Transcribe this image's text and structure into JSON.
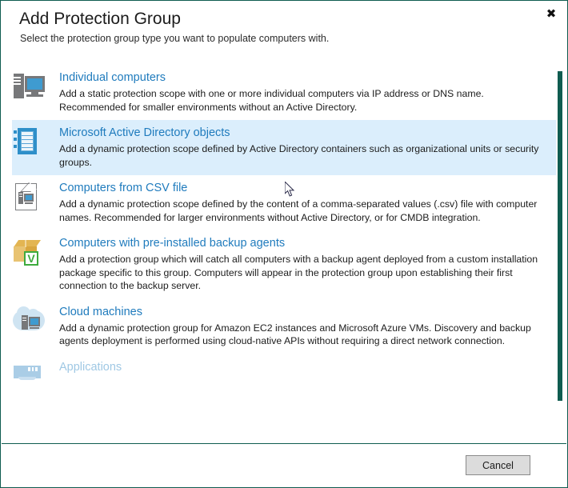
{
  "window": {
    "title": "Add Protection Group",
    "subtitle": "Select the protection group type you want to populate computers with.",
    "close_label": "✖",
    "accent_color": "#0f5c50",
    "link_color": "#1f7bbd",
    "selected_row_color": "#dbeefc"
  },
  "options": [
    {
      "icon": "computer-monitor-icon",
      "title": "Individual computers",
      "description": "Add a static protection scope with one or more individual computers via IP address or DNS name. Recommended for smaller environments without an Active Directory.",
      "selected": false,
      "disabled": false
    },
    {
      "icon": "active-directory-book-icon",
      "title": "Microsoft Active Directory objects",
      "description": "Add a dynamic protection scope defined by Active Directory containers such as organizational units or security groups.",
      "selected": true,
      "disabled": false
    },
    {
      "icon": "csv-document-icon",
      "title": "Computers from CSV file",
      "description": "Add a dynamic protection scope defined by the content of a comma-separated values (.csv) file with computer names. Recommended for larger environments without Active Directory, or for CMDB integration.",
      "selected": false,
      "disabled": false
    },
    {
      "icon": "package-box-icon",
      "title": "Computers with pre-installed backup agents",
      "description": "Add a protection group which will catch all computers with a backup agent deployed from a custom installation package specific to this group. Computers will appear in the protection group upon establishing their first connection to the backup server.",
      "badge_letter": "V",
      "selected": false,
      "disabled": false
    },
    {
      "icon": "cloud-server-icon",
      "title": "Cloud machines",
      "description": "Add a dynamic protection group for Amazon EC2 instances and Microsoft Azure VMs. Discovery and backup agents deployment is performed using cloud-native APIs without requiring a direct network connection.",
      "selected": false,
      "disabled": false
    },
    {
      "icon": "applications-icon",
      "title": "Applications",
      "description": "",
      "selected": false,
      "disabled": true
    }
  ],
  "scrollbar": {
    "orientation": "vertical",
    "thumb_position_percent": 1
  },
  "footer": {
    "cancel_label": "Cancel"
  }
}
